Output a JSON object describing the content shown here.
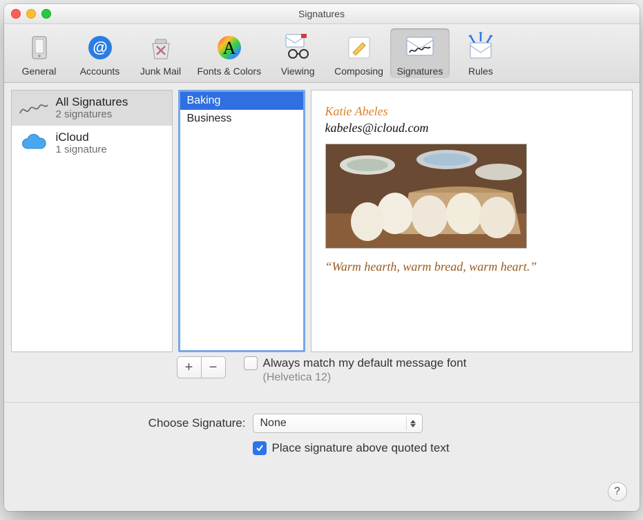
{
  "window": {
    "title": "Signatures"
  },
  "toolbar": {
    "items": [
      {
        "label": "General"
      },
      {
        "label": "Accounts"
      },
      {
        "label": "Junk Mail"
      },
      {
        "label": "Fonts & Colors"
      },
      {
        "label": "Viewing"
      },
      {
        "label": "Composing"
      },
      {
        "label": "Signatures"
      },
      {
        "label": "Rules"
      }
    ],
    "selected_index": 6
  },
  "accounts_column": {
    "items": [
      {
        "title": "All Signatures",
        "subtitle": "2 signatures",
        "selected": true,
        "icon": "signature"
      },
      {
        "title": "iCloud",
        "subtitle": "1 signature",
        "selected": false,
        "icon": "icloud"
      }
    ]
  },
  "signatures_column": {
    "items": [
      {
        "name": "Baking",
        "selected": true
      },
      {
        "name": "Business",
        "selected": false
      }
    ]
  },
  "buttons": {
    "add": "+",
    "remove": "−"
  },
  "match_font": {
    "checkbox_checked": false,
    "label": "Always match my default message font",
    "detail": "(Helvetica 12)"
  },
  "choose_signature": {
    "label": "Choose Signature:",
    "value": "None"
  },
  "place_above": {
    "checkbox_checked": true,
    "label": "Place signature above quoted text"
  },
  "help": {
    "glyph": "?"
  },
  "preview": {
    "display_name": "Katie Abeles",
    "email": "kabeles@icloud.com",
    "quote": "“Warm hearth, warm bread, warm heart.”"
  }
}
